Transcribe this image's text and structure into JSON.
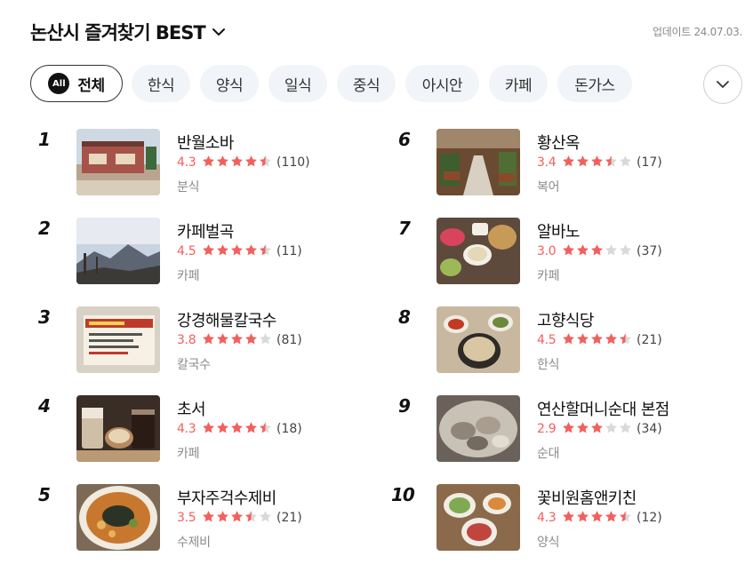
{
  "header": {
    "title": "논산시 즐겨찾기 BEST",
    "updated": "업데이트 24.07.03."
  },
  "filters": {
    "all_badge": "All",
    "items": [
      "전체",
      "한식",
      "양식",
      "일식",
      "중식",
      "아시안",
      "카페",
      "돈가스"
    ]
  },
  "colors": {
    "accent_red": "#f2605d",
    "star_filled": "#f2605d",
    "star_empty": "#d9d9d9",
    "chip_bg": "#f1f4f8"
  },
  "rankings": [
    {
      "rank": "1",
      "name": "반월소바",
      "score": "4.3",
      "stars": 4.3,
      "count": "(110)",
      "category": "분식",
      "thumb": "restaurant-exterior"
    },
    {
      "rank": "2",
      "name": "카페벌곡",
      "score": "4.5",
      "stars": 4.5,
      "count": "(11)",
      "category": "카페",
      "thumb": "mountain-sky"
    },
    {
      "rank": "3",
      "name": "강경해물칼국수",
      "score": "3.8",
      "stars": 3.8,
      "count": "(81)",
      "category": "칼국수",
      "thumb": "menu-board"
    },
    {
      "rank": "4",
      "name": "초서",
      "score": "4.3",
      "stars": 4.3,
      "count": "(18)",
      "category": "카페",
      "thumb": "coffee-drinks"
    },
    {
      "rank": "5",
      "name": "부자주걱수제비",
      "score": "3.5",
      "stars": 3.5,
      "count": "(21)",
      "category": "수제비",
      "thumb": "noodle-soup"
    },
    {
      "rank": "6",
      "name": "황산옥",
      "score": "3.4",
      "stars": 3.4,
      "count": "(17)",
      "category": "복어",
      "thumb": "restaurant-interior"
    },
    {
      "rank": "7",
      "name": "알바노",
      "score": "3.0",
      "stars": 3.0,
      "count": "(37)",
      "category": "카페",
      "thumb": "bread-soup-table"
    },
    {
      "rank": "8",
      "name": "고향식당",
      "score": "4.5",
      "stars": 4.5,
      "count": "(21)",
      "category": "한식",
      "thumb": "korean-stew"
    },
    {
      "rank": "9",
      "name": "연산할머니순대 본점",
      "score": "2.9",
      "stars": 2.9,
      "count": "(34)",
      "category": "순대",
      "thumb": "sundae-platter"
    },
    {
      "rank": "10",
      "name": "꽃비원홈앤키친",
      "score": "4.3",
      "stars": 4.3,
      "count": "(12)",
      "category": "양식",
      "thumb": "western-dishes"
    }
  ]
}
